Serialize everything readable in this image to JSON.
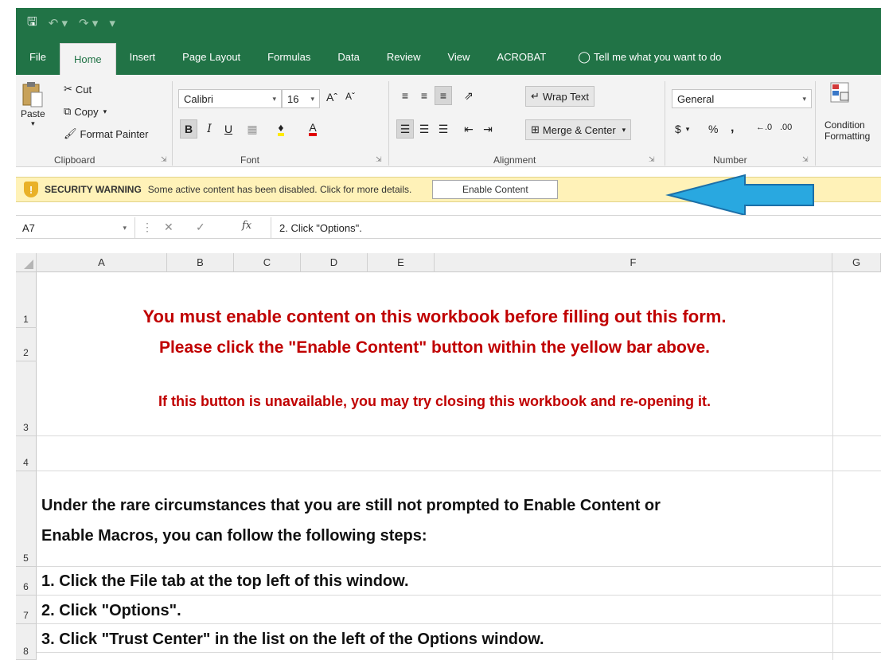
{
  "qat": {
    "save_icon": "save-icon",
    "undo_icon": "undo-icon",
    "redo_icon": "redo-icon"
  },
  "tabs": [
    "File",
    "Home",
    "Insert",
    "Page Layout",
    "Formulas",
    "Data",
    "Review",
    "View",
    "ACROBAT"
  ],
  "tell_me": "Tell me what you want to do",
  "ribbon": {
    "clipboard": {
      "paste": "Paste",
      "cut": "Cut",
      "copy": "Copy",
      "format_painter": "Format Painter",
      "label": "Clipboard"
    },
    "font": {
      "name": "Calibri",
      "size": "16",
      "label": "Font"
    },
    "alignment": {
      "wrap_text": "Wrap Text",
      "merge_center": "Merge & Center",
      "label": "Alignment"
    },
    "number": {
      "format": "General",
      "currency": "$",
      "percent": "%",
      "comma": ",",
      "label": "Number"
    },
    "styles": {
      "conditional_1": "Condition",
      "conditional_2": "Formatting"
    }
  },
  "security": {
    "title": "SECURITY WARNING",
    "message": "Some active content has been disabled. Click for more details.",
    "button": "Enable Content"
  },
  "formula_bar": {
    "name_box": "A7",
    "content": "2. Click \"Options\"."
  },
  "columns": [
    "A",
    "B",
    "C",
    "D",
    "E",
    "F",
    "G"
  ],
  "rows": [
    "1",
    "2",
    "3",
    "4",
    "5",
    "6",
    "7",
    "8"
  ],
  "cells": {
    "r1": "You must enable content on this workbook before filling out this form.",
    "r2": "Please click the \"Enable Content\" button within the yellow bar above.",
    "r3": "If this button is unavailable, you may try closing this workbook and re-opening it.",
    "r5a": "Under the rare circumstances that you are still not prompted to Enable Content or",
    "r5b": "Enable Macros, you can follow the following steps:",
    "r6": "1. Click the File tab at the top left of this window.",
    "r7": "2. Click \"Options\".",
    "r8": "3. Click \"Trust Center\" in the list on the left of the Options window."
  },
  "colors": {
    "excel_green": "#217346",
    "warning_bg": "#fff2b8",
    "red_text": "#c00000",
    "arrow_blue": "#29a8e0"
  }
}
